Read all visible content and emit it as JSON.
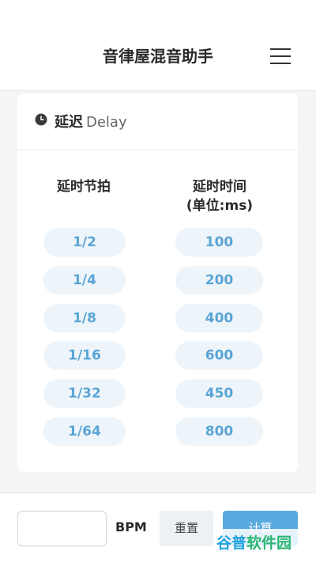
{
  "header": {
    "title": "音律屋混音助手",
    "menu_icon": "hamburger-menu-icon"
  },
  "card": {
    "icon": "clock-icon",
    "title_cn": "延迟",
    "title_en": "Delay",
    "col_left_header": "延时节拍",
    "col_right_header_line1": "延时时间",
    "col_right_header_line2": "(单位:ms)",
    "rows": [
      {
        "beat": "1/2",
        "time": "100"
      },
      {
        "beat": "1/4",
        "time": "200"
      },
      {
        "beat": "1/8",
        "time": "400"
      },
      {
        "beat": "1/16",
        "time": "600"
      },
      {
        "beat": "1/32",
        "time": "450"
      },
      {
        "beat": "1/64",
        "time": "800"
      }
    ]
  },
  "footer": {
    "bpm_value": "",
    "bpm_label": "BPM",
    "reset_label": "重置",
    "calc_label": "计算"
  },
  "watermark": {
    "part1": "谷普",
    "part2": "软件园"
  },
  "colors": {
    "accent": "#5aa5d6",
    "pill_bg": "#eef5fa",
    "calc_bg": "#5aaae0",
    "page_bg": "#f4f5f7"
  }
}
